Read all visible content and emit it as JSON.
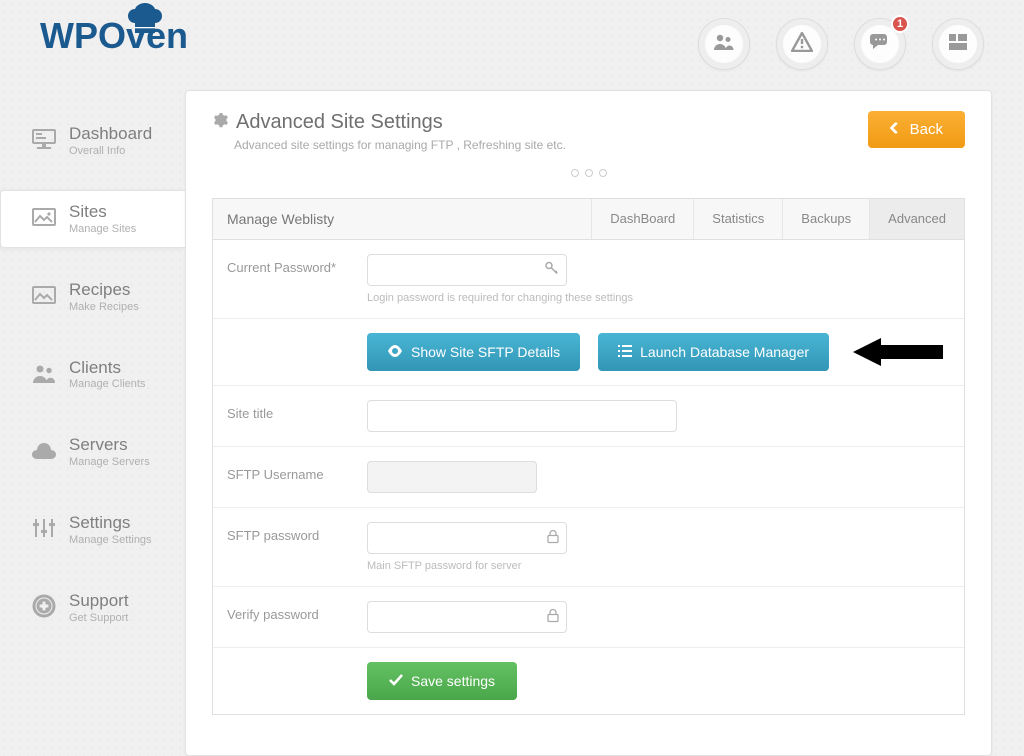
{
  "header": {
    "logo_wp": "WP",
    "logo_oven": "Oven",
    "notification_badge": "1"
  },
  "sidebar": {
    "items": [
      {
        "title": "Dashboard",
        "sub": "Overall Info"
      },
      {
        "title": "Sites",
        "sub": "Manage Sites"
      },
      {
        "title": "Recipes",
        "sub": "Make Recipes"
      },
      {
        "title": "Clients",
        "sub": "Manage Clients"
      },
      {
        "title": "Servers",
        "sub": "Manage Servers"
      },
      {
        "title": "Settings",
        "sub": "Manage Settings"
      },
      {
        "title": "Support",
        "sub": "Get Support"
      }
    ]
  },
  "page": {
    "title": "Advanced Site Settings",
    "subtitle": "Advanced site settings for managing FTP , Refreshing site etc.",
    "back_label": "Back"
  },
  "tabs": {
    "manage_label": "Manage Weblisty",
    "items": [
      "DashBoard",
      "Statistics",
      "Backups",
      "Advanced"
    ]
  },
  "form": {
    "current_password_label": "Current Password*",
    "current_password_hint": "Login password is required for changing these settings",
    "show_sftp_label": "Show Site SFTP Details",
    "launch_db_label": "Launch Database Manager",
    "site_title_label": "Site title",
    "site_title_value": "",
    "sftp_user_label": "SFTP Username",
    "sftp_user_value": "",
    "sftp_pass_label": "SFTP password",
    "sftp_pass_hint": "Main SFTP password for server",
    "verify_pass_label": "Verify password",
    "save_label": "Save settings"
  }
}
